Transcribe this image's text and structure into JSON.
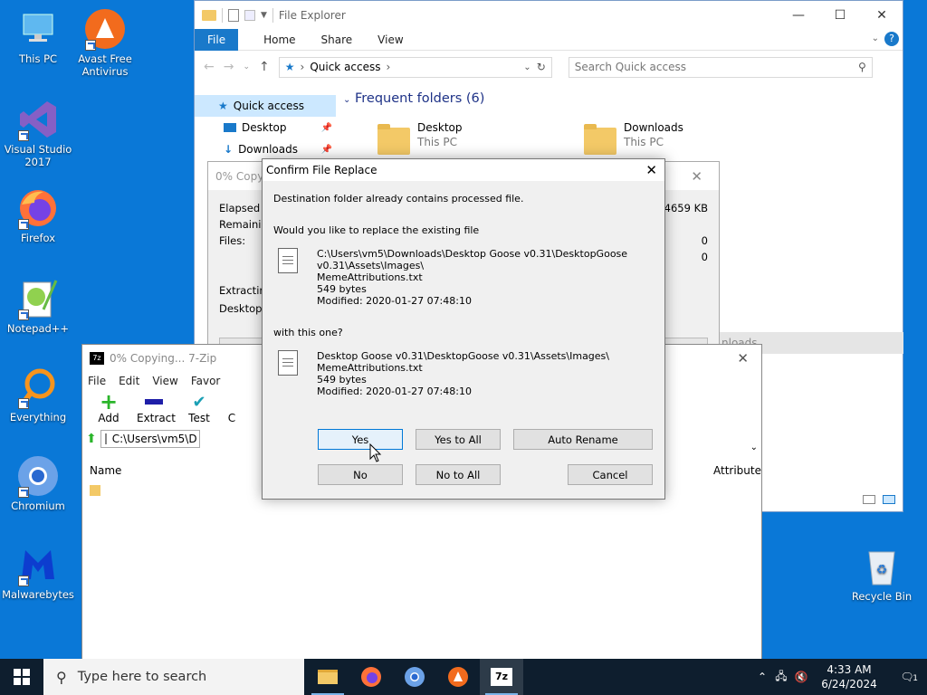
{
  "desktop": {
    "icons": [
      {
        "label": "This PC",
        "icon": "this-pc-icon"
      },
      {
        "label": "Avast Free Antivirus",
        "icon": "avast-icon"
      },
      {
        "label": "Visual Studio 2017",
        "icon": "visual-studio-icon"
      },
      {
        "label": "Firefox",
        "icon": "firefox-icon"
      },
      {
        "label": "Notepad++",
        "icon": "notepadpp-icon"
      },
      {
        "label": "Everything",
        "icon": "everything-icon"
      },
      {
        "label": "Chromium",
        "icon": "chromium-icon"
      },
      {
        "label": "Malwarebytes",
        "icon": "malwarebytes-icon"
      },
      {
        "label": "Recycle Bin",
        "icon": "recycle-bin-icon"
      }
    ]
  },
  "explorer": {
    "title": "File Explorer",
    "ribbon_tabs": [
      "File",
      "Home",
      "Share",
      "View"
    ],
    "address": "Quick access",
    "search_placeholder": "Search Quick access",
    "nav": [
      "Quick access",
      "Desktop",
      "Downloads"
    ],
    "frequent_header": "Frequent folders (6)",
    "folders": [
      {
        "name": "Desktop",
        "sub": "This PC"
      },
      {
        "name": "Downloads",
        "sub": "This PC"
      }
    ],
    "partial_text": "nloads"
  },
  "progress": {
    "title": "0% Copyi",
    "labels": [
      "Elapsed ti",
      "Remaining",
      "Files:",
      "Extracting",
      "Desktop G"
    ],
    "size": "4659 KB",
    "files_a": "0",
    "files_b": "0"
  },
  "sevenzip": {
    "title": "0% Copying... 7-Zip",
    "menu": [
      "File",
      "Edit",
      "View",
      "Favor"
    ],
    "tools": [
      "Add",
      "Extract",
      "Test",
      "C"
    ],
    "path": "C:\\Users\\vm5\\D",
    "col_name": "Name",
    "col_attr": "Attribute"
  },
  "confirm": {
    "title": "Confirm File Replace",
    "message": "Destination folder already contains processed file.",
    "question": "Would you like to replace the existing file",
    "existing": {
      "path1": "C:\\Users\\vm5\\Downloads\\Desktop Goose v0.31\\DesktopGoose",
      "path2": "v0.31\\Assets\\Images\\",
      "name": "MemeAttributions.txt",
      "size": "549 bytes",
      "modified": "Modified: 2020-01-27 07:48:10"
    },
    "with_this": "with this one?",
    "new": {
      "path1": "Desktop Goose v0.31\\DesktopGoose v0.31\\Assets\\Images\\",
      "name": "MemeAttributions.txt",
      "size": "549 bytes",
      "modified": "Modified: 2020-01-27 07:48:10"
    },
    "buttons": {
      "yes": "Yes",
      "yes_all": "Yes to All",
      "auto_rename": "Auto Rename",
      "no": "No",
      "no_all": "No to All",
      "cancel": "Cancel"
    }
  },
  "taskbar": {
    "search_placeholder": "Type here to search",
    "time": "4:33 AM",
    "date": "6/24/2024",
    "notification_count": "1"
  }
}
